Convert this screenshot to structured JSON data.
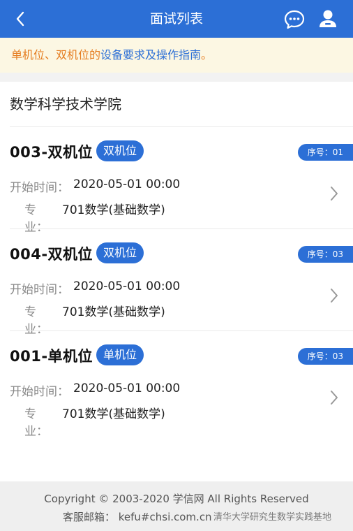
{
  "header": {
    "title": "面试列表",
    "back_icon": "chevron-left-icon",
    "chat_icon": "chat-bubble-icon",
    "user_icon": "user-icon",
    "bar_color": "#2c6fd6"
  },
  "notice": {
    "prefix": "单机位、双机位的",
    "link": "设备要求及操作指南",
    "suffix": "。"
  },
  "school": "数学科学技术学院",
  "interviews": [
    {
      "title": "003-双机位",
      "tag": "双机位",
      "seq": "序号：01",
      "start_label": "开始时间：",
      "start_value": "2020-05-01 00:00",
      "major_label": "专业：",
      "major_value": "701数学(基础数学)"
    },
    {
      "title": "004-双机位",
      "tag": "双机位",
      "seq": "序号：03",
      "start_label": "开始时间：",
      "start_value": "2020-05-01 00:00",
      "major_label": "专业：",
      "major_value": "701数学(基础数学)"
    },
    {
      "title": "001-单机位",
      "tag": "单机位",
      "seq": "序号：03",
      "start_label": "开始时间：",
      "start_value": "2020-05-01 00:00",
      "major_label": "专业：",
      "major_value": "701数学(基础数学)"
    }
  ],
  "footer": {
    "copyright": "Copyright © 2003-2020 学信网 All Rights Reserved",
    "contact": "客服邮箱：  kefu#chsi.com.cn",
    "watermark": "清华大学研究生数学实践基地"
  }
}
